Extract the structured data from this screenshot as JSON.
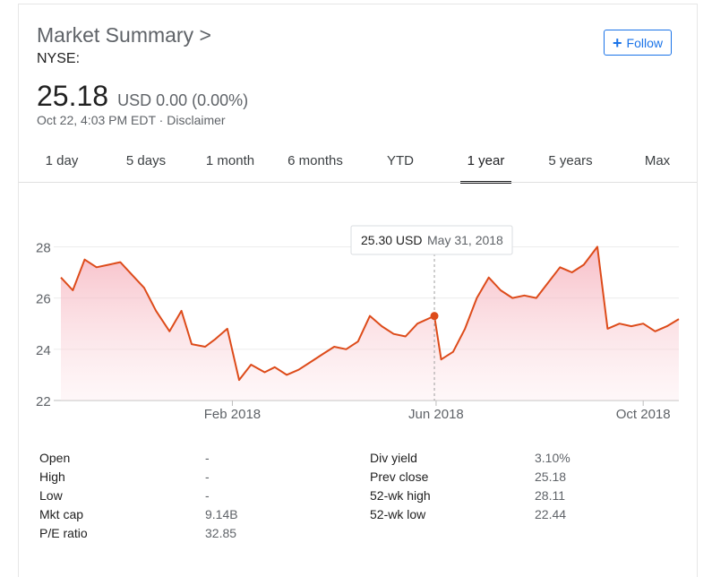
{
  "header": {
    "title": "Market Summary",
    "title_chevron": ">",
    "exchange": "NYSE:",
    "follow_icon": "+",
    "follow_label": "Follow"
  },
  "quote": {
    "price": "25.18",
    "currency": "USD",
    "change": "0.00 (0.00%)",
    "timestamp": "Oct 22, 4:03 PM EDT · Disclaimer"
  },
  "tabs": [
    {
      "label": "1 day",
      "active": false
    },
    {
      "label": "5 days",
      "active": false
    },
    {
      "label": "1 month",
      "active": false
    },
    {
      "label": "6 months",
      "active": false
    },
    {
      "label": "YTD",
      "active": false
    },
    {
      "label": "1 year",
      "active": true
    },
    {
      "label": "5 years",
      "active": false
    },
    {
      "label": "Max",
      "active": false
    }
  ],
  "chart_data": {
    "type": "area",
    "title": "",
    "xlabel": "",
    "ylabel": "",
    "ylim": [
      22,
      28.4
    ],
    "xlim": [
      "2017-10-23",
      "2018-10-22"
    ],
    "y_ticks": [
      "28",
      "26",
      "24",
      "22"
    ],
    "x_ticks": [
      "Feb 2018",
      "Jun 2018",
      "Oct 2018"
    ],
    "series": [
      {
        "color": "#dd4b1a",
        "x": [
          "2017-10-23",
          "2017-10-30",
          "2017-11-06",
          "2017-11-13",
          "2017-11-20",
          "2017-11-27",
          "2017-12-04",
          "2017-12-11",
          "2017-12-18",
          "2017-12-26",
          "2018-01-02",
          "2018-01-08",
          "2018-01-16",
          "2018-01-22",
          "2018-01-29",
          "2018-02-05",
          "2018-02-12",
          "2018-02-20",
          "2018-02-26",
          "2018-03-05",
          "2018-03-12",
          "2018-03-19",
          "2018-03-26",
          "2018-04-02",
          "2018-04-09",
          "2018-04-16",
          "2018-04-23",
          "2018-04-30",
          "2018-05-07",
          "2018-05-14",
          "2018-05-21",
          "2018-05-31",
          "2018-06-04",
          "2018-06-11",
          "2018-06-18",
          "2018-06-25",
          "2018-07-02",
          "2018-07-09",
          "2018-07-16",
          "2018-07-23",
          "2018-07-30",
          "2018-08-06",
          "2018-08-13",
          "2018-08-20",
          "2018-08-27",
          "2018-09-04",
          "2018-09-10",
          "2018-09-17",
          "2018-09-24",
          "2018-10-01",
          "2018-10-08",
          "2018-10-15",
          "2018-10-22"
        ],
        "values": [
          26.8,
          26.3,
          27.5,
          27.2,
          27.3,
          27.4,
          26.9,
          26.4,
          25.5,
          24.7,
          25.5,
          24.2,
          24.1,
          24.4,
          24.8,
          22.8,
          23.4,
          23.1,
          23.3,
          23.0,
          23.2,
          23.5,
          23.8,
          24.1,
          24.0,
          24.3,
          25.3,
          24.9,
          24.6,
          24.5,
          25.0,
          25.3,
          23.6,
          23.9,
          24.8,
          26.0,
          26.8,
          26.3,
          26.0,
          26.1,
          26.0,
          26.6,
          27.2,
          27.0,
          27.3,
          28.0,
          24.8,
          25.0,
          24.9,
          25.0,
          24.7,
          24.9,
          25.18
        ]
      }
    ],
    "tooltip": {
      "value": "25.30 USD",
      "date": "May 31, 2018",
      "x": "2018-05-31",
      "y": 25.3
    }
  },
  "stats": {
    "left": [
      {
        "label": "Open",
        "value": "-"
      },
      {
        "label": "High",
        "value": "-"
      },
      {
        "label": "Low",
        "value": "-"
      },
      {
        "label": "Mkt cap",
        "value": "9.14B"
      },
      {
        "label": "P/E ratio",
        "value": "32.85"
      }
    ],
    "right": [
      {
        "label": "Div yield",
        "value": "3.10%"
      },
      {
        "label": "Prev close",
        "value": "25.18"
      },
      {
        "label": "52-wk high",
        "value": "28.11"
      },
      {
        "label": "52-wk low",
        "value": "22.44"
      }
    ]
  }
}
